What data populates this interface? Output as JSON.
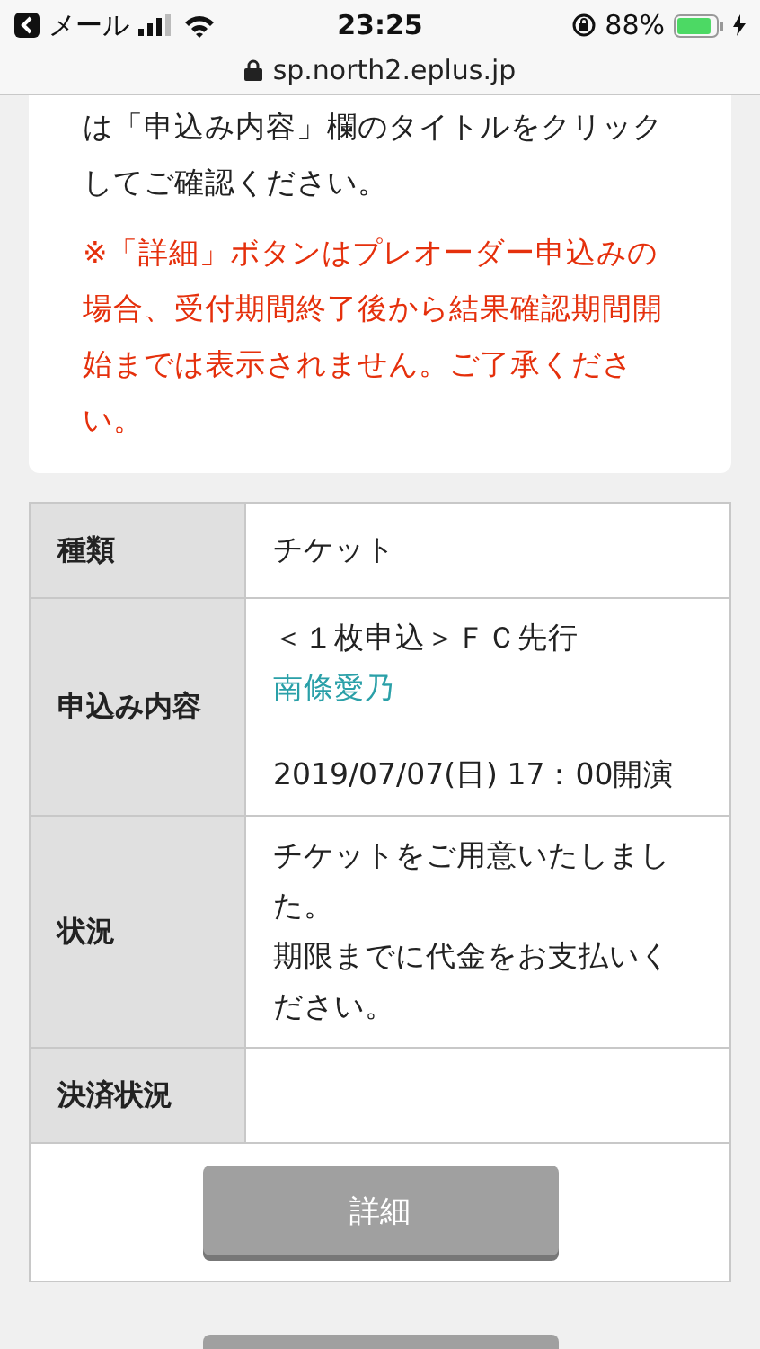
{
  "status_bar": {
    "back_app": "メール",
    "time": "23:25",
    "battery": {
      "text": "88%",
      "level": 0.88
    }
  },
  "address_bar": {
    "url": "sp.north2.eplus.jp"
  },
  "notice": [
    {
      "kind": "normal",
      "text": "は「申込み内容」欄のタイトルをクリックしてご確認ください。"
    },
    {
      "kind": "warning",
      "text": "※「詳細」ボタンはプレオーダー申込みの場合、受付期間終了後から結果確認期間開始までは表示されません。ご了承ください。"
    }
  ],
  "details_table": {
    "rows": [
      {
        "label": "種類",
        "lines": [
          {
            "kind": "text",
            "text": "チケット"
          }
        ]
      },
      {
        "label": "申込み内容",
        "lines": [
          {
            "kind": "text",
            "text": "＜１枚申込＞ＦＣ先行"
          },
          {
            "kind": "link",
            "text": "南條愛乃"
          },
          {
            "kind": "spaced",
            "text": "2019/07/07(日) 17：00開演"
          }
        ]
      },
      {
        "label": "状況",
        "lines": [
          {
            "kind": "text",
            "text": "チケットをご用意いたしました。"
          },
          {
            "kind": "text",
            "text": "期限までに代金をお支払いください。"
          }
        ]
      },
      {
        "label": "決済状況",
        "lines": []
      }
    ],
    "button": "詳細"
  }
}
